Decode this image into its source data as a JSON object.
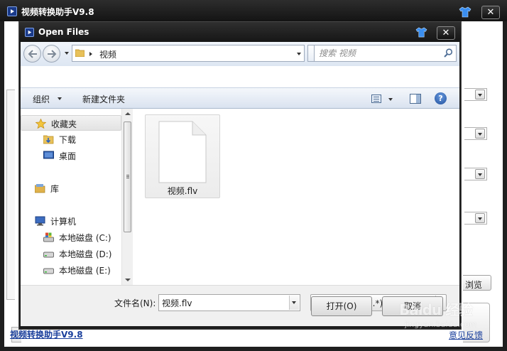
{
  "app": {
    "title": "视频转换助手V9.8",
    "footer_link_left": "视频转换助手V9.8",
    "footer_link_right": "意见反馈",
    "browse_partial": "浏览"
  },
  "dialog": {
    "title": "Open Files",
    "address": {
      "path": "视频"
    },
    "search": {
      "placeholder": "搜索 视频"
    },
    "toolbar": {
      "organize": "组织",
      "new_folder": "新建文件夹"
    },
    "nav": {
      "items": [
        {
          "label": "收藏夹",
          "icon": "star-icon",
          "selected": true
        },
        {
          "label": "下载",
          "icon": "downloads-folder-icon"
        },
        {
          "label": "桌面",
          "icon": "desktop-icon"
        },
        {
          "label": "库",
          "icon": "library-icon"
        },
        {
          "label": "计算机",
          "icon": "computer-icon"
        },
        {
          "label": "本地磁盘 (C:)",
          "icon": "system-drive-icon"
        },
        {
          "label": "本地磁盘 (D:)",
          "icon": "drive-icon"
        },
        {
          "label": "本地磁盘 (E:)",
          "icon": "drive-icon"
        }
      ]
    },
    "files": [
      {
        "name": "视频.flv",
        "icon": "file-icon"
      }
    ],
    "filename": {
      "label": "文件名(N):",
      "value": "视频.flv"
    },
    "filetype": {
      "selected": "所有格式文件(*.*)"
    },
    "buttons": {
      "open": "打开(O)",
      "cancel": "取消"
    }
  },
  "watermark": {
    "text": "Baidu 经验",
    "sub": "jingyan.baidu.com"
  },
  "colors": {
    "titlebar": "#1f1f1f",
    "link": "#1a3f9c",
    "toolbar_gradient_top": "#f4f7fb",
    "toolbar_gradient_bottom": "#dae3f0"
  }
}
